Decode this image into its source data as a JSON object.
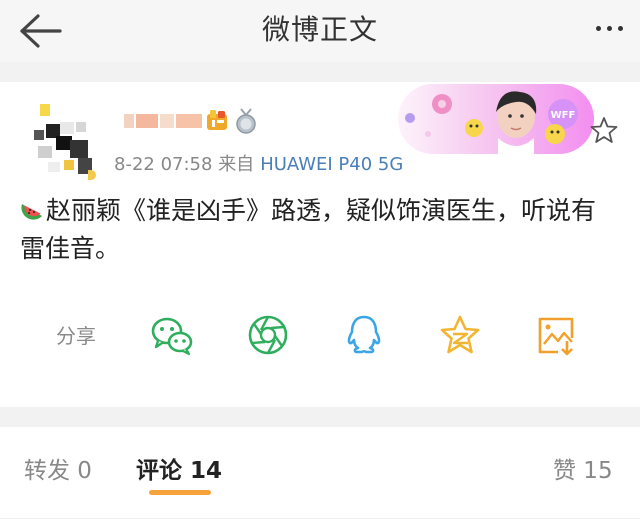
{
  "nav": {
    "title": "微博正文",
    "back_icon": "back-arrow-icon",
    "more_icon": "more-dots-icon"
  },
  "post": {
    "timestamp": "8-22 07:58",
    "source_prefix": "来自",
    "device": "HUAWEI P40 5G",
    "banner_label": "WFF",
    "content": "赵丽颖《谁是凶手》路透，疑似饰演医生，听说有雷佳音。",
    "share_label": "分享"
  },
  "tabs": {
    "repost": "转发 0",
    "comments": "评论 14",
    "likes": "赞 15"
  },
  "colors": {
    "accent_orange": "#f7a33b",
    "device_blue": "#4a7fb8",
    "wechat_green": "#2fae5d",
    "qq_blue": "#3aa6e6",
    "star_yellow": "#f2b531",
    "save_orange": "#f2a02b"
  }
}
